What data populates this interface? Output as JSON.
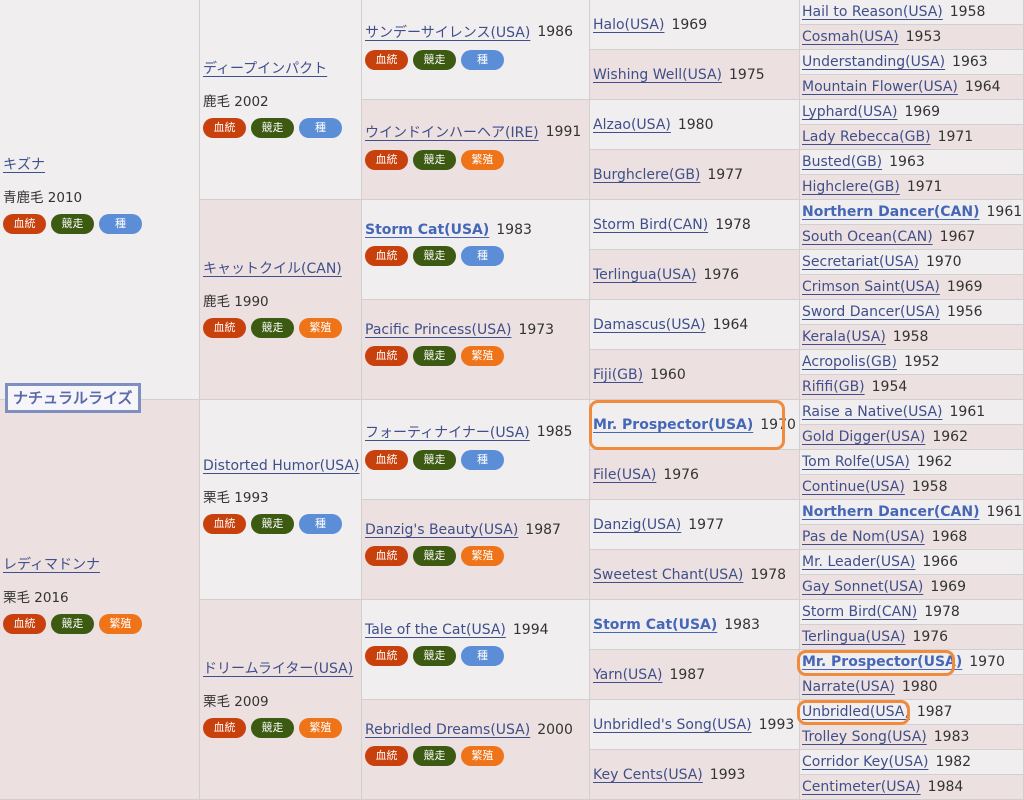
{
  "title": "ナチュラルライズ",
  "badge_labels": {
    "blood": "血統",
    "race": "競走",
    "seed": "種",
    "breed": "繁殖"
  },
  "gen1": [
    {
      "name": "キズナ",
      "info": "青鹿毛 2010",
      "badges": [
        "blood",
        "race",
        "seed"
      ]
    },
    {
      "name": "レディマドンナ",
      "info": "栗毛 2016",
      "badges": [
        "blood",
        "race",
        "breed"
      ]
    }
  ],
  "gen2": [
    {
      "name": "ディープインパクト",
      "info": "鹿毛 2002",
      "badges": [
        "blood",
        "race",
        "seed"
      ]
    },
    {
      "name": "キャットクイル(CAN)",
      "info": "鹿毛 1990",
      "badges": [
        "blood",
        "race",
        "breed"
      ]
    },
    {
      "name": "Distorted Humor(USA)",
      "info": "栗毛 1993",
      "badges": [
        "blood",
        "race",
        "seed"
      ]
    },
    {
      "name": "ドリームライター(USA)",
      "info": "栗毛 2009",
      "badges": [
        "blood",
        "race",
        "breed"
      ]
    }
  ],
  "gen3": [
    {
      "name": "サンデーサイレンス(USA)",
      "year": "1986",
      "badges": [
        "blood",
        "race",
        "seed"
      ]
    },
    {
      "name": "ウインドインハーヘア(IRE)",
      "year": "1991",
      "badges": [
        "blood",
        "race",
        "breed"
      ]
    },
    {
      "name": "Storm Cat(USA)",
      "year": "1983",
      "bold": true,
      "badges": [
        "blood",
        "race",
        "seed"
      ]
    },
    {
      "name": "Pacific Princess(USA)",
      "year": "1973",
      "badges": [
        "blood",
        "race",
        "breed"
      ]
    },
    {
      "name": "フォーティナイナー(USA)",
      "year": "1985",
      "badges": [
        "blood",
        "race",
        "seed"
      ]
    },
    {
      "name": "Danzig's Beauty(USA)",
      "year": "1987",
      "badges": [
        "blood",
        "race",
        "breed"
      ]
    },
    {
      "name": "Tale of the Cat(USA)",
      "year": "1994",
      "badges": [
        "blood",
        "race",
        "seed"
      ]
    },
    {
      "name": "Rebridled Dreams(USA)",
      "year": "2000",
      "badges": [
        "blood",
        "race",
        "breed"
      ]
    }
  ],
  "gen4": [
    {
      "name": "Halo(USA)",
      "year": "1969"
    },
    {
      "name": "Wishing Well(USA)",
      "year": "1975"
    },
    {
      "name": "Alzao(USA)",
      "year": "1980"
    },
    {
      "name": "Burghclere(GB)",
      "year": "1977"
    },
    {
      "name": "Storm Bird(CAN)",
      "year": "1978"
    },
    {
      "name": "Terlingua(USA)",
      "year": "1976"
    },
    {
      "name": "Damascus(USA)",
      "year": "1964"
    },
    {
      "name": "Fiji(GB)",
      "year": "1960"
    },
    {
      "name": "Mr. Prospector(USA)",
      "year": "1970",
      "bold": true
    },
    {
      "name": "File(USA)",
      "year": "1976"
    },
    {
      "name": "Danzig(USA)",
      "year": "1977"
    },
    {
      "name": "Sweetest Chant(USA)",
      "year": "1978"
    },
    {
      "name": "Storm Cat(USA)",
      "year": "1983",
      "bold": true
    },
    {
      "name": "Yarn(USA)",
      "year": "1987"
    },
    {
      "name": "Unbridled's Song(USA)",
      "year": "1993"
    },
    {
      "name": "Key Cents(USA)",
      "year": "1993"
    }
  ],
  "gen5": [
    {
      "name": "Hail to Reason(USA)",
      "year": "1958"
    },
    {
      "name": "Cosmah(USA)",
      "year": "1953"
    },
    {
      "name": "Understanding(USA)",
      "year": "1963"
    },
    {
      "name": "Mountain Flower(USA)",
      "year": "1964"
    },
    {
      "name": "Lyphard(USA)",
      "year": "1969"
    },
    {
      "name": "Lady Rebecca(GB)",
      "year": "1971"
    },
    {
      "name": "Busted(GB)",
      "year": "1963"
    },
    {
      "name": "Highclere(GB)",
      "year": "1971"
    },
    {
      "name": "Northern Dancer(CAN)",
      "year": "1961",
      "bold": true
    },
    {
      "name": "South Ocean(CAN)",
      "year": "1967"
    },
    {
      "name": "Secretariat(USA)",
      "year": "1970"
    },
    {
      "name": "Crimson Saint(USA)",
      "year": "1969"
    },
    {
      "name": "Sword Dancer(USA)",
      "year": "1956"
    },
    {
      "name": "Kerala(USA)",
      "year": "1958"
    },
    {
      "name": "Acropolis(GB)",
      "year": "1952"
    },
    {
      "name": "Rififi(GB)",
      "year": "1954"
    },
    {
      "name": "Raise a Native(USA)",
      "year": "1961"
    },
    {
      "name": "Gold Digger(USA)",
      "year": "1962"
    },
    {
      "name": "Tom Rolfe(USA)",
      "year": "1962"
    },
    {
      "name": "Continue(USA)",
      "year": "1958"
    },
    {
      "name": "Northern Dancer(CAN)",
      "year": "1961",
      "bold": true
    },
    {
      "name": "Pas de Nom(USA)",
      "year": "1968"
    },
    {
      "name": "Mr. Leader(USA)",
      "year": "1966"
    },
    {
      "name": "Gay Sonnet(USA)",
      "year": "1969"
    },
    {
      "name": "Storm Bird(CAN)",
      "year": "1978"
    },
    {
      "name": "Terlingua(USA)",
      "year": "1976"
    },
    {
      "name": "Mr. Prospector(USA)",
      "year": "1970",
      "bold": true
    },
    {
      "name": "Narrate(USA)",
      "year": "1980"
    },
    {
      "name": "Unbridled(USA)",
      "year": "1987"
    },
    {
      "name": "Trolley Song(USA)",
      "year": "1983"
    },
    {
      "name": "Corridor Key(USA)",
      "year": "1982"
    },
    {
      "name": "Centimeter(USA)",
      "year": "1984"
    }
  ],
  "colors": {
    "highlight": "#f08a3c",
    "link": "#3f4f8a",
    "bold_link": "#4567b7"
  }
}
